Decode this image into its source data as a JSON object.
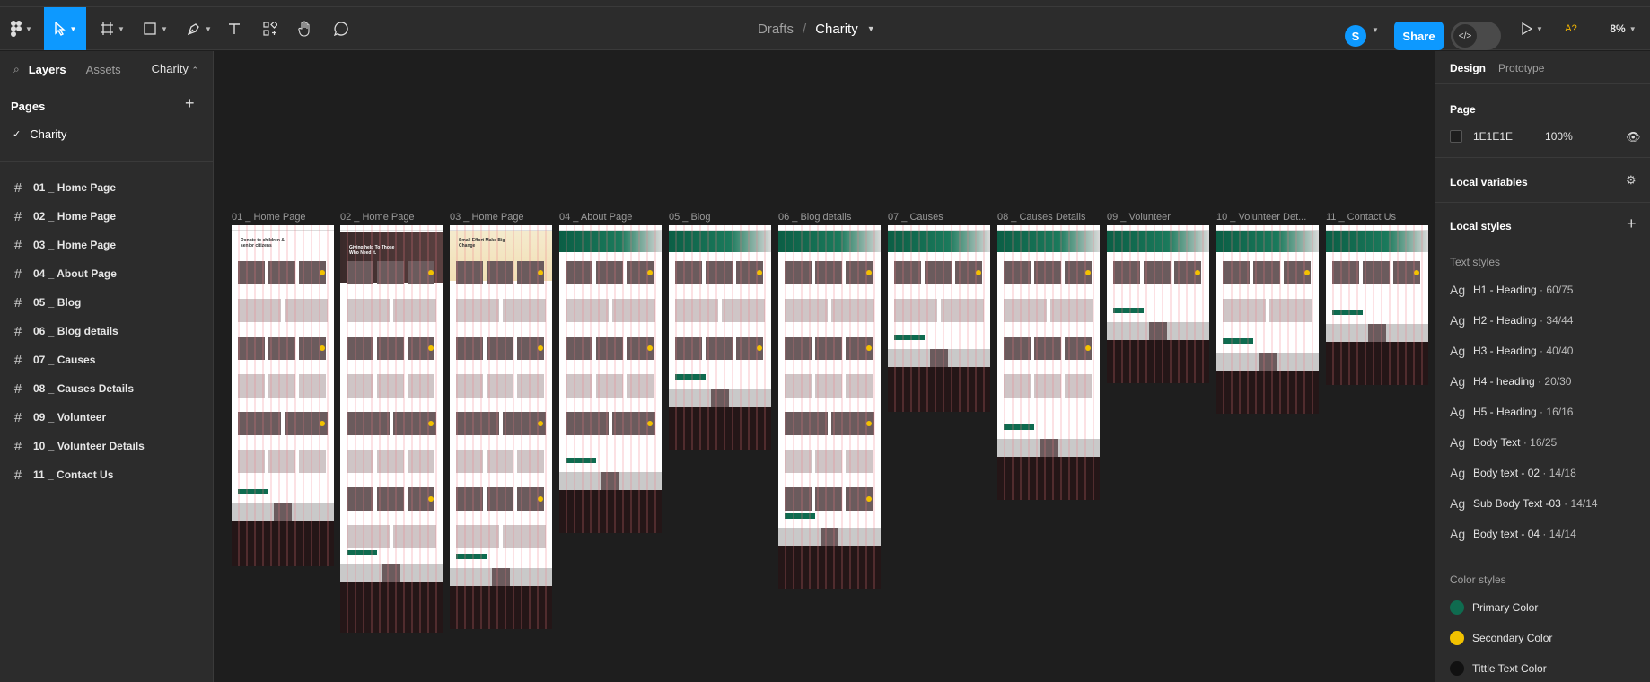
{
  "toolbar": {
    "tools": [
      {
        "name": "main-menu",
        "icon": "figma-logo-icon"
      },
      {
        "name": "move",
        "icon": "cursor-arrow-icon"
      },
      {
        "name": "frame",
        "icon": "frame-hash-icon"
      },
      {
        "name": "shape",
        "icon": "rectangle-icon"
      },
      {
        "name": "pen",
        "icon": "pen-icon"
      },
      {
        "name": "text",
        "icon": "text-icon"
      },
      {
        "name": "resources",
        "icon": "components-icon"
      },
      {
        "name": "hand",
        "icon": "hand-icon"
      },
      {
        "name": "comment",
        "icon": "comment-icon"
      }
    ],
    "breadcrumb": {
      "folder": "Drafts",
      "separator": "/",
      "file": "Charity"
    },
    "avatar_initial": "S",
    "share_label": "Share",
    "ai_label": "A?",
    "zoom": "8%"
  },
  "left_panel": {
    "tabs": [
      "Layers",
      "Assets"
    ],
    "current_page_selector": "Charity",
    "pages_heading": "Pages",
    "pages": [
      {
        "label": "Charity",
        "checked": true
      }
    ],
    "layers": [
      "01 _ Home Page",
      "02 _ Home Page",
      "03 _ Home Page",
      "04 _ About Page",
      "05 _ Blog",
      "06 _ Blog details",
      "07 _ Causes",
      "08 _ Causes Details",
      "09 _ Volunteer",
      "10 _ Volunteer Details",
      "11 _ Contact Us"
    ]
  },
  "canvas": {
    "frame_labels": [
      "01 _ Home Page",
      "02 _ Home Page",
      "03 _ Home Page",
      "04 _ About Page",
      "05 _ Blog",
      "06 _ Blog details",
      "07 _ Causes",
      "08 _ Causes Details",
      "09 _ Volunteer",
      "10 _ Volunteer Det...",
      "11 _ Contact Us"
    ],
    "home1_hero_text": "Donate to children & senior citizens",
    "home2_hero_text": "Giving help To Those Who Need It.",
    "home3_hero_text": "Small Effort Make Big Change"
  },
  "right_panel": {
    "tabs": [
      "Design",
      "Prototype"
    ],
    "page_heading": "Page",
    "page_fill_hex": "1E1E1E",
    "page_fill_opacity": "100%",
    "local_variables": "Local variables",
    "local_styles": "Local styles",
    "text_styles_heading": "Text styles",
    "text_styles": [
      {
        "glyph": "Ag",
        "name": "H1 - Heading",
        "spec": "60/75"
      },
      {
        "glyph": "Ag",
        "name": "H2 - Heading",
        "spec": "34/44"
      },
      {
        "glyph": "Ag",
        "name": "H3 - Heading",
        "spec": "40/40"
      },
      {
        "glyph": "Ag",
        "name": "H4 - heading",
        "spec": "20/30"
      },
      {
        "glyph": "Ag",
        "name": "H5 - Heading",
        "spec": "16/16"
      },
      {
        "glyph": "Ag",
        "name": "Body Text",
        "spec": "16/25"
      },
      {
        "glyph": "Ag",
        "name": "Body text - 02",
        "spec": "14/18"
      },
      {
        "glyph": "Ag",
        "name": "Sub Body Text -03",
        "spec": "14/14"
      },
      {
        "glyph": "Ag",
        "name": "Body text - 04",
        "spec": "14/14"
      }
    ],
    "color_styles_heading": "Color styles",
    "color_styles": [
      {
        "name": "Primary Color",
        "color": "#0f6b4f"
      },
      {
        "name": "Secondary Color",
        "color": "#f2c200"
      },
      {
        "name": "Tittle Text Color",
        "color": "#111111"
      }
    ]
  }
}
